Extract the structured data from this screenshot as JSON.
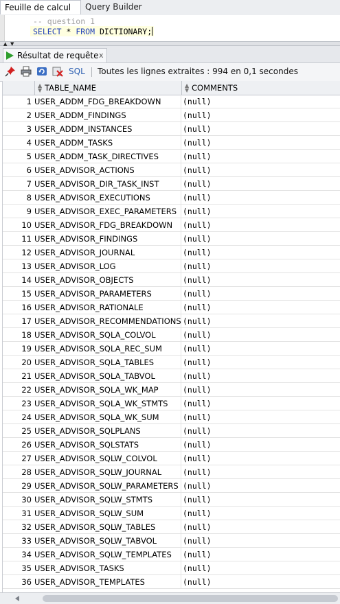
{
  "tabs": {
    "worksheet": "Feuille de calcul",
    "query_builder": "Query Builder"
  },
  "editor": {
    "line1": "-- question 1",
    "line2_kw1": "SELECT",
    "line2_mid": " * ",
    "line2_kw2": "FROM",
    "line2_rest": " DICTIONARY;"
  },
  "results": {
    "tab_label": "Résultat de requête",
    "tab_close": "x",
    "sql_label": "SQL",
    "status": "Toutes les lignes extraites : 994 en 0,1 secondes"
  },
  "grid": {
    "columns": [
      "TABLE_NAME",
      "COMMENTS"
    ],
    "rows": [
      {
        "n": "1",
        "name": "USER_ADDM_FDG_BREAKDOWN",
        "comment": "(null)"
      },
      {
        "n": "2",
        "name": "USER_ADDM_FINDINGS",
        "comment": "(null)"
      },
      {
        "n": "3",
        "name": "USER_ADDM_INSTANCES",
        "comment": "(null)"
      },
      {
        "n": "4",
        "name": "USER_ADDM_TASKS",
        "comment": "(null)"
      },
      {
        "n": "5",
        "name": "USER_ADDM_TASK_DIRECTIVES",
        "comment": "(null)"
      },
      {
        "n": "6",
        "name": "USER_ADVISOR_ACTIONS",
        "comment": "(null)"
      },
      {
        "n": "7",
        "name": "USER_ADVISOR_DIR_TASK_INST",
        "comment": "(null)"
      },
      {
        "n": "8",
        "name": "USER_ADVISOR_EXECUTIONS",
        "comment": "(null)"
      },
      {
        "n": "9",
        "name": "USER_ADVISOR_EXEC_PARAMETERS",
        "comment": "(null)"
      },
      {
        "n": "10",
        "name": "USER_ADVISOR_FDG_BREAKDOWN",
        "comment": "(null)"
      },
      {
        "n": "11",
        "name": "USER_ADVISOR_FINDINGS",
        "comment": "(null)"
      },
      {
        "n": "12",
        "name": "USER_ADVISOR_JOURNAL",
        "comment": "(null)"
      },
      {
        "n": "13",
        "name": "USER_ADVISOR_LOG",
        "comment": "(null)"
      },
      {
        "n": "14",
        "name": "USER_ADVISOR_OBJECTS",
        "comment": "(null)"
      },
      {
        "n": "15",
        "name": "USER_ADVISOR_PARAMETERS",
        "comment": "(null)"
      },
      {
        "n": "16",
        "name": "USER_ADVISOR_RATIONALE",
        "comment": "(null)"
      },
      {
        "n": "17",
        "name": "USER_ADVISOR_RECOMMENDATIONS",
        "comment": "(null)"
      },
      {
        "n": "18",
        "name": "USER_ADVISOR_SQLA_COLVOL",
        "comment": "(null)"
      },
      {
        "n": "19",
        "name": "USER_ADVISOR_SQLA_REC_SUM",
        "comment": "(null)"
      },
      {
        "n": "20",
        "name": "USER_ADVISOR_SQLA_TABLES",
        "comment": "(null)"
      },
      {
        "n": "21",
        "name": "USER_ADVISOR_SQLA_TABVOL",
        "comment": "(null)"
      },
      {
        "n": "22",
        "name": "USER_ADVISOR_SQLA_WK_MAP",
        "comment": "(null)"
      },
      {
        "n": "23",
        "name": "USER_ADVISOR_SQLA_WK_STMTS",
        "comment": "(null)"
      },
      {
        "n": "24",
        "name": "USER_ADVISOR_SQLA_WK_SUM",
        "comment": "(null)"
      },
      {
        "n": "25",
        "name": "USER_ADVISOR_SQLPLANS",
        "comment": "(null)"
      },
      {
        "n": "26",
        "name": "USER_ADVISOR_SQLSTATS",
        "comment": "(null)"
      },
      {
        "n": "27",
        "name": "USER_ADVISOR_SQLW_COLVOL",
        "comment": "(null)"
      },
      {
        "n": "28",
        "name": "USER_ADVISOR_SQLW_JOURNAL",
        "comment": "(null)"
      },
      {
        "n": "29",
        "name": "USER_ADVISOR_SQLW_PARAMETERS",
        "comment": "(null)"
      },
      {
        "n": "30",
        "name": "USER_ADVISOR_SQLW_STMTS",
        "comment": "(null)"
      },
      {
        "n": "31",
        "name": "USER_ADVISOR_SQLW_SUM",
        "comment": "(null)"
      },
      {
        "n": "32",
        "name": "USER_ADVISOR_SQLW_TABLES",
        "comment": "(null)"
      },
      {
        "n": "33",
        "name": "USER_ADVISOR_SQLW_TABVOL",
        "comment": "(null)"
      },
      {
        "n": "34",
        "name": "USER_ADVISOR_SQLW_TEMPLATES",
        "comment": "(null)"
      },
      {
        "n": "35",
        "name": "USER_ADVISOR_TASKS",
        "comment": "(null)"
      },
      {
        "n": "36",
        "name": "USER_ADVISOR_TEMPLATES",
        "comment": "(null)"
      }
    ]
  },
  "icons": [
    "pin-icon",
    "print-icon",
    "refresh-icon",
    "cancel-icon",
    "play-icon",
    "sort-icon"
  ],
  "colors": {
    "accent": "#2a5db0",
    "run": "#2e9e2e",
    "keyword": "#1f3fb8"
  }
}
